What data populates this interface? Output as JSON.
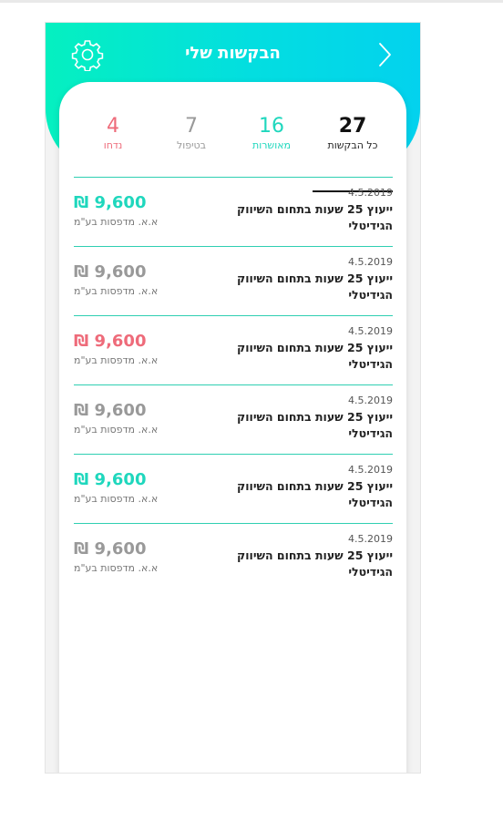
{
  "header": {
    "title": "הבקשות שלי",
    "gradient_start": "#05f0c0",
    "gradient_end": "#03d2ee"
  },
  "icons": {
    "settings": "gear-icon",
    "back": "chevron-right-icon"
  },
  "tabs": [
    {
      "count": "27",
      "label": "כל הבקשות",
      "color": "#111111",
      "selected": true
    },
    {
      "count": "16",
      "label": "מאושרות",
      "color": "#1fd7bd"
    },
    {
      "count": "7",
      "label": "בטיפול",
      "color": "#999999"
    },
    {
      "count": "4",
      "label": "נדחו",
      "color": "#ee6b7a"
    }
  ],
  "requests": [
    {
      "date": "4.5.2019",
      "title": "ייעוץ 25 שעות בתחום השיווק הגידיטלי",
      "amount": "₪ 9,600",
      "vendor": "א.א. מדפסות בע\"מ",
      "status_color": "#1fd7bd"
    },
    {
      "date": "4.5.2019",
      "title": "ייעוץ 25 שעות בתחום השיווק הגידיטלי",
      "amount": "₪ 9,600",
      "vendor": "א.א. מדפסות בע\"מ",
      "status_color": "#999999"
    },
    {
      "date": "4.5.2019",
      "title": "ייעוץ 25 שעות בתחום השיווק הגידיטלי",
      "amount": "₪ 9,600",
      "vendor": "א.א. מדפסות בע\"מ",
      "status_color": "#ee6b7a"
    },
    {
      "date": "4.5.2019",
      "title": "ייעוץ 25 שעות בתחום השיווק הגידיטלי",
      "amount": "₪ 9,600",
      "vendor": "א.א. מדפסות בע\"מ",
      "status_color": "#999999"
    },
    {
      "date": "4.5.2019",
      "title": "ייעוץ 25 שעות בתחום השיווק הגידיטלי",
      "amount": "₪ 9,600",
      "vendor": "א.א. מדפסות בע\"מ",
      "status_color": "#1fd7bd"
    },
    {
      "date": "4.5.2019",
      "title": "ייעוץ 25 שעות בתחום השיווק הגידיטלי",
      "amount": "₪ 9,600",
      "vendor": "א.א. מדפסות בע\"מ",
      "status_color": "#999999"
    }
  ]
}
